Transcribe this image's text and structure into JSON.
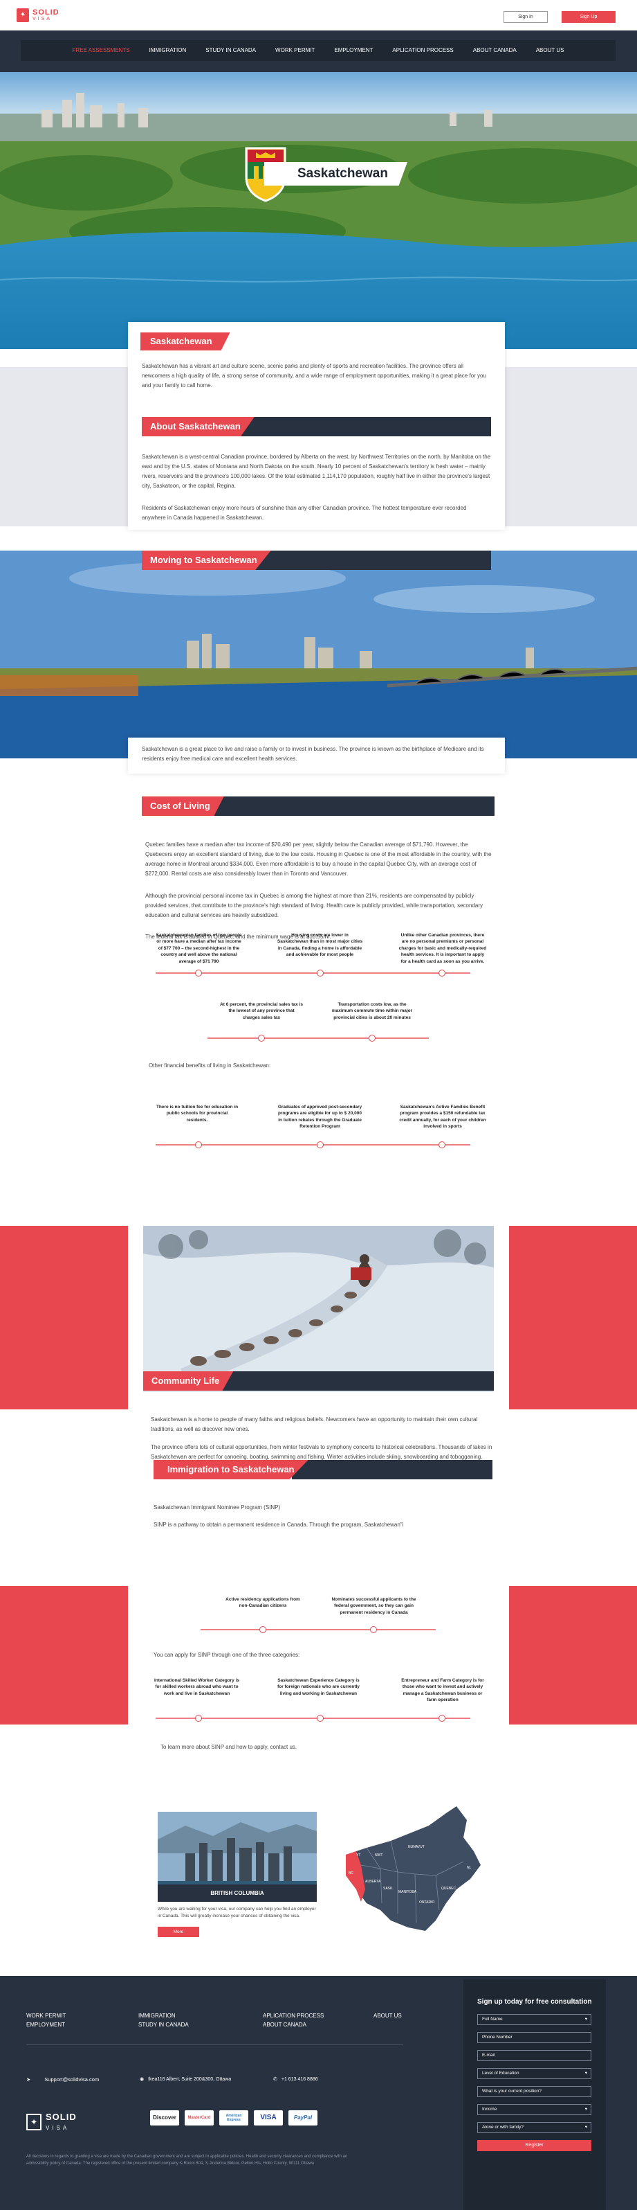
{
  "header": {
    "logo_main": "SOLID",
    "logo_sub": "VISA",
    "signin": "Sign In",
    "signup": "Sign Up"
  },
  "nav": {
    "items": [
      "FREE ASSESSMENTS",
      "IMMIGRATION",
      "STUDY IN CANADA",
      "WORK PERMIT",
      "EMPLOYMENT",
      "APLICATION PROCESS",
      "ABOUT CANADA",
      "ABOUT US"
    ]
  },
  "hero": {
    "title": "Saskatchewan"
  },
  "intro": {
    "title": "Saskatchewan",
    "text": "Saskatchewan has a vibrant art and culture scene, scenic parks and plenty of sports and recreation facilities. The province offers all newcomers a high quality of life, a strong sense of community, and a wide range of employment opportunities, making it a great place for you and your family to call home."
  },
  "about": {
    "title": "About Saskatchewan",
    "p1": "Saskatchewan is a west-central Canadian province, bordered by Alberta on the west, by Northwest Territories on the north, by Manitoba on the east and by the U.S. states of Montana and North Dakota on the south. Nearly 10 percent of Saskatchewan's territory is fresh water – mainly rivers, reservoirs and the province's 100,000 lakes. Of the total estimated 1,114,170 population, roughly half live in either the province's largest city, Saskatoon, or the capital, Regina.",
    "p2": "Residents of Saskatchewan enjoy more hours of sunshine than any other Canadian province. The hottest temperature ever recorded anywhere in Canada happened in Saskatchewan."
  },
  "moving": {
    "title": "Moving to Saskatchewan",
    "text": "Saskatchewan is a great place to live and raise a family or to invest in business. The province is known as the birthplace of Medicare and its residents enjoy free medical care and excellent health services."
  },
  "cost": {
    "title": "Cost of Living",
    "p1": "Quebec families have a median after tax income of $70,490 per year, slightly below the Canadian average of $71,790. However, the Quebecers enjoy an excellent standard of living, due to the low costs. Housing in Quebec is one of the most affordable in the country, with the average home in Montreal around $334,000. Even more affordable is to buy a house in the capital Quebec City, with an average cost of $272,000. Rental costs are also considerably lower than in Toronto and Vancouver.",
    "p2": "Although the provincial personal income tax in Quebec is among the highest at more than 21%, residents are compensated by publicly provided services, that contribute to the province's high standard of living. Health care is publicly provided, while transportation, secondary education and cultural services are heavily subsidized.",
    "p3": "The federal tax is abated in Quebec, and the minimum wage is at $10.55/hr.",
    "timeline1": [
      "Saskatchewanian families of two people or more have a median after tax income of $77 700 – the second-highest in the country and well above the national average of $71 790",
      "Housing costs are lower in Saskatchewan than in most major cities in Canada, finding a home is affordable and achievable for most people",
      "Unlike other Canadian provinces, there are no personal premiums or personal charges for basic and medically-required health services. It is important to apply for a health card as soon as you arrive."
    ],
    "timeline2": [
      "At 6 percent, the provincial sales tax is the lowest of any province that charges sales tax",
      "Transportation costs low, as the maximum commute time within major provincial cities is about 20 minutes"
    ],
    "other_title": "Other financial benefits of living in Saskatchewan:",
    "timeline3": [
      "There is no tuition fee for education in public schools for provincial residents.",
      "Graduates of approved post-secondary programs are eligible for up to $ 20,000 in tuition rebates through the Graduate Retention Program",
      "Saskatchewan's Active Families Benefit program provides a $150 refundable tax credit annually, for each of your children involved in sports"
    ]
  },
  "community": {
    "title": "Community Life",
    "p1": "Saskatchewan is a home to people of many faiths and religious beliefs. Newcomers have an opportunity to maintain their own cultural traditions, as well as discover new ones.",
    "p2": "The province offers lots of cultural opportunities, from winter festivals to symphony concerts to historical celebrations. Thousands of lakes in Saskatchewan are perfect for canoeing, boating, swimming and fishing. Winter activities include skiing, snowboarding and tobogganing."
  },
  "immigration": {
    "title": "Immigration to Saskatchewan",
    "p1": "Saskatchewan Immigrant Nominee Program (SINP)",
    "p2": "SINP is a pathway to obtain a permanent residence in Canada. Through the program, Saskatchewan\"i",
    "steps1": [
      "Active residency applications from non-Canadian citizens",
      "Nominates successful applicants to the federal government, so they can gain permanent residency in Canada"
    ],
    "apply_text": "You can apply for SINP through one of the three categories:",
    "steps2": [
      "International Skilled Worker Category is for skilled workers abroad who want to work and live in Saskatchewan",
      "Saskatchewan Experience Category is for foreign nationals who are currently living and working in Saskatchewan",
      "Entrepreneur and Farm Category is for those who want to invest and actively manage a Saskatchewan business or farm operation"
    ],
    "learn_more": "To learn more about SINP and how to apply, contact us."
  },
  "province_card": {
    "name": "BRITISH COLUMBIA",
    "text": "While you are waiting for your visa, our company can help you find an employer in Canada. This will greatly increase your chances of obtaining the visa.",
    "button": "More"
  },
  "map": {
    "labels": [
      "BC",
      "ALBERTA",
      "SASK.",
      "MANITOBA",
      "ONTARIO",
      "QUEBEC",
      "YT",
      "NWT",
      "NUNAVUT",
      "NL",
      "NB",
      "NS",
      "PEI"
    ]
  },
  "footer": {
    "links_col1": [
      "WORK PERMIT",
      "EMPLOYMENT"
    ],
    "links_col2": [
      "IMMIGRATION",
      "STUDY IN CANADA"
    ],
    "links_col3": [
      "APLICATION PROCESS",
      "ABOUT CANADA"
    ],
    "links_col4": [
      "ABOUT US"
    ],
    "email": "Support@solidvisa.com",
    "address": "Ikea116 Albert, Suite 200&300, Ottawa",
    "phone": "+1 613 416 8886",
    "logo_main": "SOLID",
    "logo_sub": "VISA",
    "payments": [
      "Discover",
      "MasterCard",
      "American Express",
      "VISA",
      "PayPal"
    ],
    "disclaimer": "All decisions in regards to granting a visa are made by the Canadian government and are subject to applicable policies. Health and security clearances and compliance with an admissibility policy of Canada. The registered office of the present limited company is Room 604, 3, Anderina Bldoor, Gellon Hts, Hollo County, 90111 Ottawa",
    "form": {
      "title": "Sign up today for free consultation",
      "full_name": "Full Name",
      "phone": "Phone Number",
      "email": "E-mail",
      "education": "Level of Education",
      "position": "What is your current position?",
      "income": "Income",
      "family": "Alone or with family?",
      "submit": "Register"
    }
  },
  "colors": {
    "accent": "#e8474f",
    "dark": "#27313f",
    "gray": "#e7e8ee"
  }
}
